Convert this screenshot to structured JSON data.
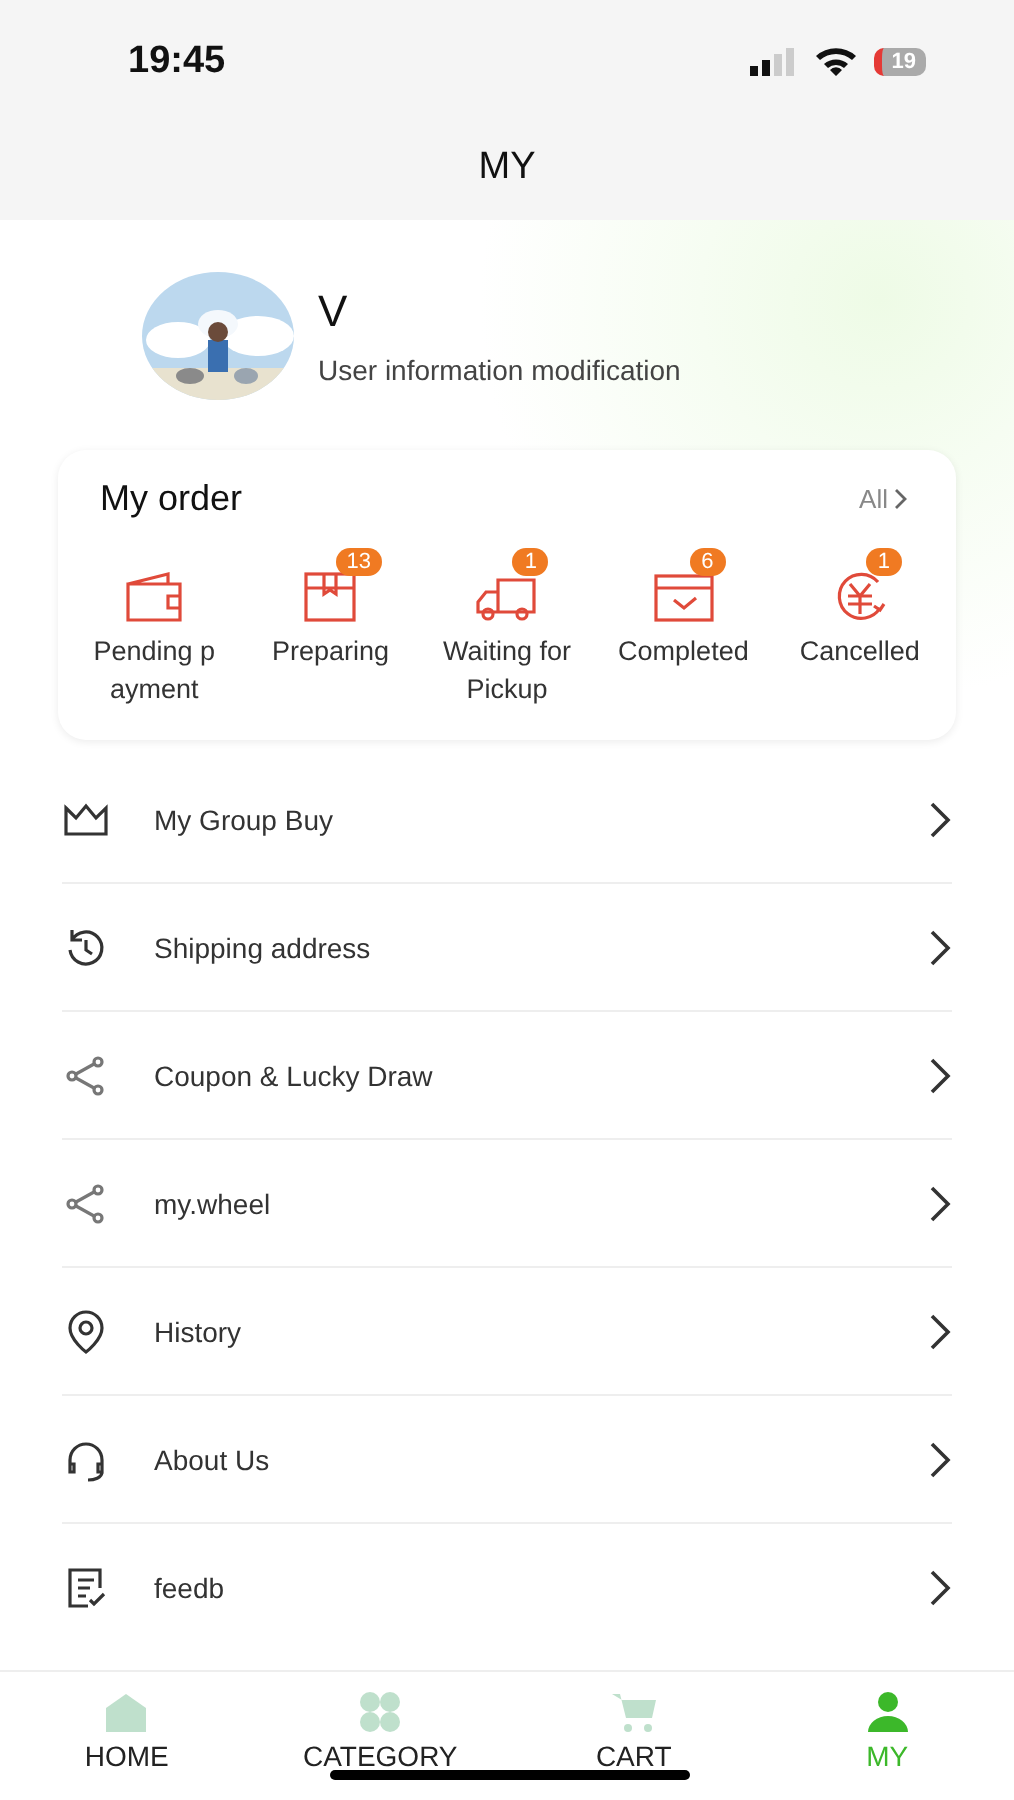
{
  "status_bar": {
    "time": "19:45",
    "battery": "19"
  },
  "header": {
    "title": "MY"
  },
  "profile": {
    "name": "V",
    "subtitle": "User information modification"
  },
  "orders": {
    "title": "My order",
    "all_link": "All",
    "items": [
      {
        "kind": "wallet",
        "lines": [
          "Pending p",
          "ayment"
        ]
      },
      {
        "kind": "box",
        "lines": [
          "Preparing"
        ],
        "badge": "13"
      },
      {
        "kind": "truck",
        "lines": [
          "Waiting for",
          "Pickup"
        ],
        "badge": "1"
      },
      {
        "kind": "check",
        "lines": [
          "Completed"
        ],
        "badge": "6"
      },
      {
        "kind": "refund",
        "lines": [
          "Cancelled"
        ],
        "badge": "1"
      }
    ]
  },
  "menu": [
    {
      "kind": "crown",
      "label": "My Group Buy"
    },
    {
      "kind": "history",
      "label": "Shipping address"
    },
    {
      "kind": "share",
      "label": "Coupon & Lucky Draw"
    },
    {
      "kind": "share",
      "label": "my.wheel"
    },
    {
      "kind": "location",
      "label": "History"
    },
    {
      "kind": "headset",
      "label": "About Us"
    },
    {
      "kind": "form",
      "label": "feedb"
    }
  ],
  "tab_bar": [
    {
      "kind": "home",
      "label": "HOME",
      "selected": false
    },
    {
      "kind": "category",
      "label": "CATEGORY",
      "selected": false
    },
    {
      "kind": "cart",
      "label": "CART",
      "selected": false
    },
    {
      "kind": "user",
      "label": "MY",
      "selected": true
    }
  ]
}
